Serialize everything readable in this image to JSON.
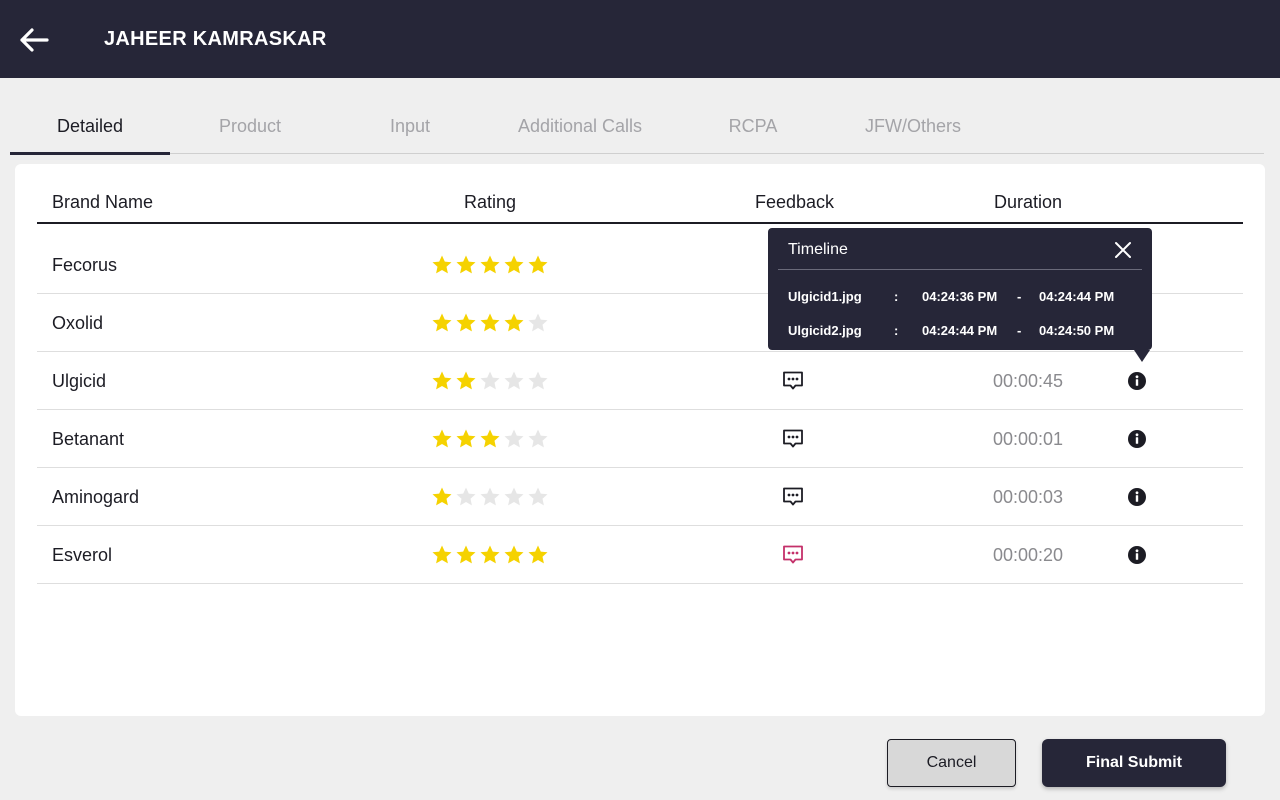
{
  "header": {
    "title": "JAHEER KAMRASKAR",
    "back_icon": "arrow-left-icon"
  },
  "tabs": [
    {
      "label": "Detailed",
      "active": true
    },
    {
      "label": "Product",
      "active": false
    },
    {
      "label": "Input",
      "active": false
    },
    {
      "label": "Additional Calls",
      "active": false
    },
    {
      "label": "RCPA",
      "active": false
    },
    {
      "label": "JFW/Others",
      "active": false
    }
  ],
  "table": {
    "columns": [
      "Brand Name",
      "Rating",
      "Feedback",
      "Duration"
    ],
    "max_rating": 5,
    "rows": [
      {
        "brand": "Fecorus",
        "rating": 5,
        "feedback": false,
        "feedback_highlight": false,
        "duration": ""
      },
      {
        "brand": "Oxolid",
        "rating": 4,
        "feedback": false,
        "feedback_highlight": false,
        "duration": ""
      },
      {
        "brand": "Ulgicid",
        "rating": 2,
        "feedback": true,
        "feedback_highlight": false,
        "duration": "00:00:45"
      },
      {
        "brand": "Betanant",
        "rating": 3,
        "feedback": true,
        "feedback_highlight": false,
        "duration": "00:00:01"
      },
      {
        "brand": "Aminogard",
        "rating": 1,
        "feedback": true,
        "feedback_highlight": false,
        "duration": "00:00:03"
      },
      {
        "brand": "Esverol",
        "rating": 5,
        "feedback": true,
        "feedback_highlight": true,
        "duration": "00:00:20"
      }
    ]
  },
  "timeline_popup": {
    "title": "Timeline",
    "entries": [
      {
        "file": "Ulgicid1.jpg",
        "sep": ":",
        "start": "04:24:36 PM",
        "dash": "-",
        "end": "04:24:44 PM"
      },
      {
        "file": "Ulgicid2.jpg",
        "sep": ":",
        "start": "04:24:44 PM",
        "dash": "-",
        "end": "04:24:50 PM"
      }
    ]
  },
  "actions": {
    "cancel_label": "Cancel",
    "submit_label": "Final Submit"
  },
  "colors": {
    "header_bg": "#262638",
    "star_filled": "#f5d200",
    "star_empty": "#e6e6e6",
    "feedback_highlight": "#c4306a"
  }
}
